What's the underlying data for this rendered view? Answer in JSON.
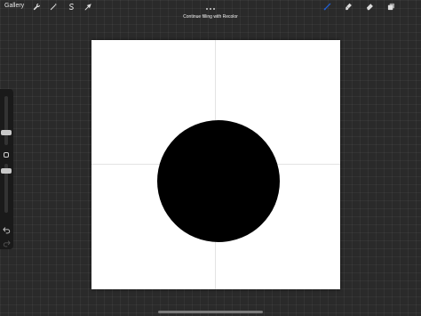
{
  "topbar": {
    "gallery_label": "Gallery",
    "left_tools": [
      "actions-wrench-icon",
      "adjustments-wand-icon",
      "selection-s-icon",
      "transform-arrow-icon"
    ],
    "right_tools": [
      "brush-icon",
      "smudge-icon",
      "eraser-icon",
      "layers-icon"
    ],
    "more_menu_icon": "more-dots-icon",
    "active_tool": "brush-icon",
    "active_color": "#1f5fd6"
  },
  "status": {
    "message": "Continue filling with Recolor"
  },
  "canvas": {
    "background": "#ffffff",
    "shape": "filled-circle",
    "shape_color": "#000000",
    "guides": "drawing-guide-cross"
  },
  "sidebar": {
    "brush_size_slider_icon": "size-slider",
    "opacity_slider_icon": "opacity-slider",
    "modify_button_icon": "square-modify-icon",
    "undo_icon": "undo-arrow-icon",
    "redo_icon": "redo-arrow-icon"
  }
}
